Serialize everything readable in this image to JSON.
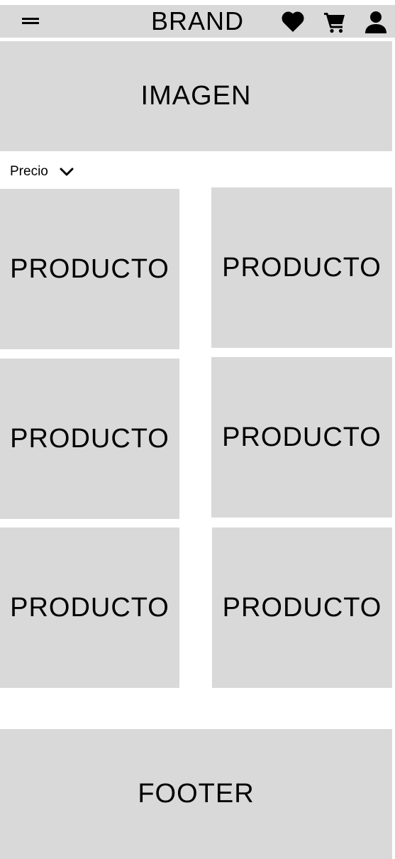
{
  "header": {
    "brand": "BRAND",
    "icons": {
      "menu": "menu-icon",
      "favorites": "heart-icon",
      "cart": "cart-icon",
      "account": "user-icon"
    }
  },
  "hero": {
    "label": "IMAGEN"
  },
  "filter": {
    "label": "Precio",
    "icon": "chevron-down-icon"
  },
  "products": [
    {
      "label": "PRODUCTO"
    },
    {
      "label": "PRODUCTO"
    },
    {
      "label": "PRODUCTO"
    },
    {
      "label": "PRODUCTO"
    },
    {
      "label": "PRODUCTO"
    },
    {
      "label": "PRODUCTO"
    }
  ],
  "footer": {
    "label": "FOOTER"
  },
  "colors": {
    "placeholder": "#d9d9d9",
    "background": "#ffffff",
    "text": "#000000"
  }
}
